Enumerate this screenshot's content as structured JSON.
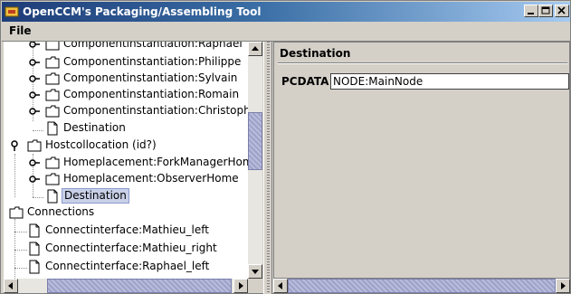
{
  "window": {
    "title": "OpenCCM's Packaging/Assembling Tool",
    "title_bar_color": "#3a6ea5",
    "controls": [
      "minimize-icon",
      "maximize-icon",
      "close-icon"
    ]
  },
  "menu": {
    "items": [
      {
        "label": "File"
      }
    ]
  },
  "tree": {
    "rows": [
      {
        "label": "Componentinstantiation:Raphael",
        "icon": "folder-icon",
        "twisty": "collapsed-toggle-icon"
      },
      {
        "label": "Componentinstantiation:Philippe",
        "icon": "folder-icon",
        "twisty": "collapsed-toggle-icon"
      },
      {
        "label": "Componentinstantiation:Sylvain",
        "icon": "folder-icon",
        "twisty": "collapsed-toggle-icon"
      },
      {
        "label": "Componentinstantiation:Romain",
        "icon": "folder-icon",
        "twisty": "collapsed-toggle-icon"
      },
      {
        "label": "Componentinstantiation:Christophe",
        "icon": "folder-icon",
        "twisty": "collapsed-toggle-icon"
      },
      {
        "label": "Destination",
        "icon": "document-icon"
      },
      {
        "label": "Hostcollocation (id?)",
        "icon": "folder-icon",
        "twisty": "expanded-toggle-icon"
      },
      {
        "label": "Homeplacement:ForkManagerHome",
        "icon": "folder-icon",
        "twisty": "collapsed-toggle-icon"
      },
      {
        "label": "Homeplacement:ObserverHome",
        "icon": "folder-icon",
        "twisty": "collapsed-toggle-icon"
      },
      {
        "label": "Destination",
        "icon": "document-icon",
        "selected": true
      },
      {
        "label": "Connections",
        "icon": "folder-icon"
      },
      {
        "label": "Connectinterface:Mathieu_left",
        "icon": "document-icon"
      },
      {
        "label": "Connectinterface:Mathieu_right",
        "icon": "document-icon"
      },
      {
        "label": "Connectinterface:Raphael_left",
        "icon": "document-icon"
      }
    ],
    "selection_color": "#c8d0e8"
  },
  "editor": {
    "title": "Destination",
    "field_label": "PCDATA :",
    "field_value": "NODE:MainNode"
  }
}
